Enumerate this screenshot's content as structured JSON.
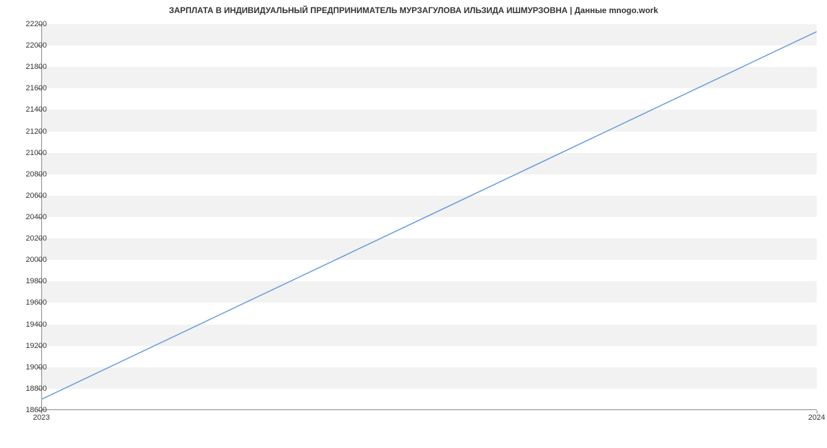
{
  "chart_data": {
    "type": "line",
    "title": "ЗАРПЛАТА В ИНДИВИДУАЛЬНЫЙ ПРЕДПРИНИМАТЕЛЬ МУРЗАГУЛОВА ИЛЬЗИДА ИШМУРЗОВНА | Данные mnogo.work",
    "x": [
      2023,
      2024
    ],
    "values": [
      18700,
      22130
    ],
    "xlabel": "",
    "ylabel": "",
    "ylim": [
      18600,
      22200
    ],
    "xlim": [
      2023,
      2024
    ],
    "y_ticks": [
      18600,
      18800,
      19000,
      19200,
      19400,
      19600,
      19800,
      20000,
      20200,
      20400,
      20600,
      20800,
      21000,
      21200,
      21400,
      21600,
      21800,
      22000,
      22200
    ],
    "x_ticks": [
      2023,
      2024
    ],
    "line_color": "#6699dd",
    "grid": true
  }
}
